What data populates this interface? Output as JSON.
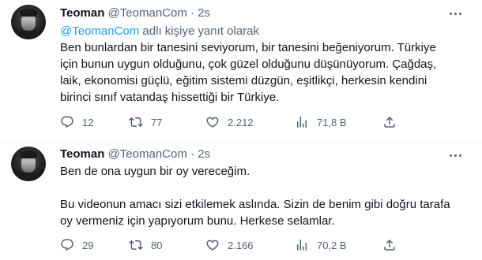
{
  "tweets": [
    {
      "name": "Teoman",
      "handle": "@TeomanCom",
      "dot": "·",
      "time": "2s",
      "reply_mention": "@TeomanCom",
      "reply_suffix": " adlı kişiye yanıt olarak",
      "text_lines": [
        "Ben bunlardan bir tanesini seviyorum, bir tanesini beğeniyorum. Türkiye",
        "için bunun uygun olduğunu, çok güzel olduğunu düşünüyorum. Çağdaş,",
        "laik, ekonomisi güçlü, eğitim sistemi düzgün, eşitlikçi, herkesin kendini",
        "birinci sınıf vatandaş hissettiği bir Türkiye."
      ],
      "replies": "12",
      "retweets": "77",
      "likes": "2.212",
      "views": "71,8 B"
    },
    {
      "name": "Teoman",
      "handle": "@TeomanCom",
      "dot": "·",
      "time": "2s",
      "paragraph1": "Ben de ona uygun bir oy vereceğim.",
      "paragraph2_lines": [
        "Bu videonun amacı sizi etkilemek aslında. Sizin de benim gibi doğru tarafa",
        "oy vermeniz için yapıyorum bunu. Herkese selamlar."
      ],
      "replies": "29",
      "retweets": "80",
      "likes": "2.166",
      "views": "70,2 B"
    }
  ],
  "icons": [
    "avatar",
    "more-icon",
    "reply-icon",
    "retweet-icon",
    "like-icon",
    "views-icon",
    "share-icon"
  ],
  "colors": {
    "text": "#0f1419",
    "secondary": "#536471",
    "link": "#1d9bf0",
    "divider": "#eff3f4"
  }
}
